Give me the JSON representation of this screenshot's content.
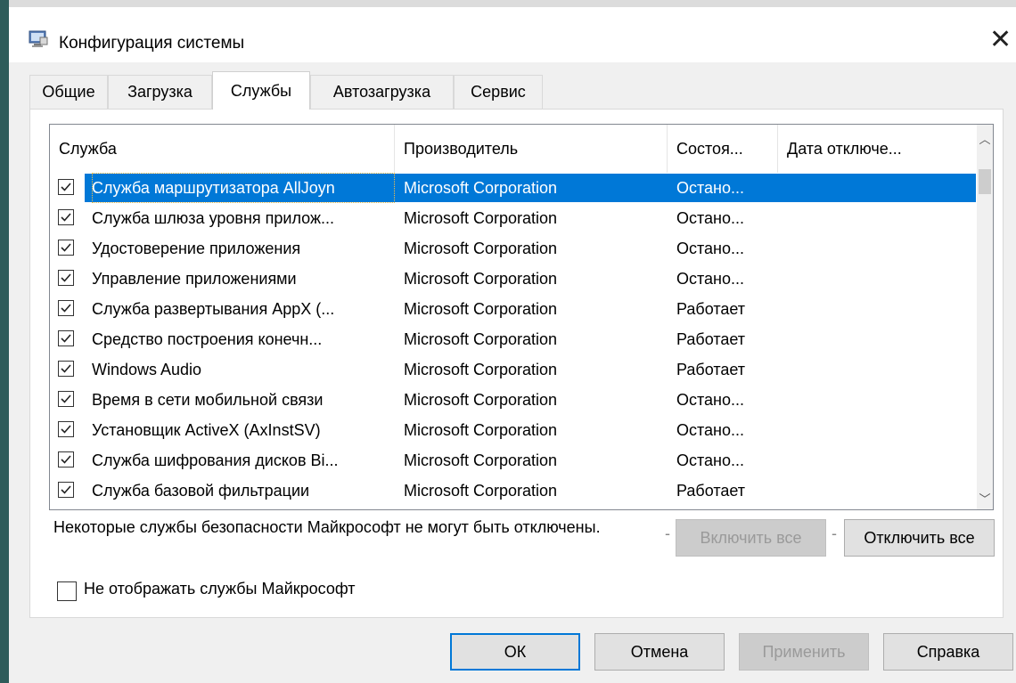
{
  "window": {
    "title": "Конфигурация системы",
    "close_glyph": "✕",
    "icon": "msconfig-icon"
  },
  "tabs": [
    {
      "label": "Общие",
      "active": false
    },
    {
      "label": "Загрузка",
      "active": false
    },
    {
      "label": "Службы",
      "active": true
    },
    {
      "label": "Автозагрузка",
      "active": false
    },
    {
      "label": "Сервис",
      "active": false
    }
  ],
  "services_table": {
    "columns": [
      "Служба",
      "Производитель",
      "Состоя...",
      "Дата отключе..."
    ],
    "rows": [
      {
        "name": "Служба маршрутизатора AllJoyn",
        "vendor": "Microsoft Corporation",
        "status": "Остано...",
        "disabled_date": "",
        "checked": true,
        "selected": true
      },
      {
        "name": "Служба шлюза уровня прилож...",
        "vendor": "Microsoft Corporation",
        "status": "Остано...",
        "disabled_date": "",
        "checked": true,
        "selected": false
      },
      {
        "name": "Удостоверение приложения",
        "vendor": "Microsoft Corporation",
        "status": "Остано...",
        "disabled_date": "",
        "checked": true,
        "selected": false
      },
      {
        "name": "Управление приложениями",
        "vendor": "Microsoft Corporation",
        "status": "Остано...",
        "disabled_date": "",
        "checked": true,
        "selected": false
      },
      {
        "name": "Служба развертывания AppX (...",
        "vendor": "Microsoft Corporation",
        "status": "Работает",
        "disabled_date": "",
        "checked": true,
        "selected": false
      },
      {
        "name": "Средство построения конечн...",
        "vendor": "Microsoft Corporation",
        "status": "Работает",
        "disabled_date": "",
        "checked": true,
        "selected": false
      },
      {
        "name": "Windows Audio",
        "vendor": "Microsoft Corporation",
        "status": "Работает",
        "disabled_date": "",
        "checked": true,
        "selected": false
      },
      {
        "name": "Время в сети мобильной связи",
        "vendor": "Microsoft Corporation",
        "status": "Остано...",
        "disabled_date": "",
        "checked": true,
        "selected": false
      },
      {
        "name": "Установщик ActiveX (AxInstSV)",
        "vendor": "Microsoft Corporation",
        "status": "Остано...",
        "disabled_date": "",
        "checked": true,
        "selected": false
      },
      {
        "name": "Служба шифрования дисков Bi...",
        "vendor": "Microsoft Corporation",
        "status": "Остано...",
        "disabled_date": "",
        "checked": true,
        "selected": false
      },
      {
        "name": "Служба базовой фильтрации",
        "vendor": "Microsoft Corporation",
        "status": "Работает",
        "disabled_date": "",
        "checked": true,
        "selected": false
      }
    ]
  },
  "note_text": "Некоторые службы безопасности Майкрософт не могут быть отключены.",
  "enable_all_label": "Включить все",
  "disable_all_label": "Отключить все",
  "hide_ms_services": {
    "label": "Не отображать службы Майкрософт",
    "checked": false
  },
  "footer": {
    "ok_label": "ОК",
    "cancel_label": "Отмена",
    "apply_label": "Применить",
    "help_label": "Справка"
  },
  "colors": {
    "selection": "#0078d7",
    "background": "#f0f0f0"
  }
}
